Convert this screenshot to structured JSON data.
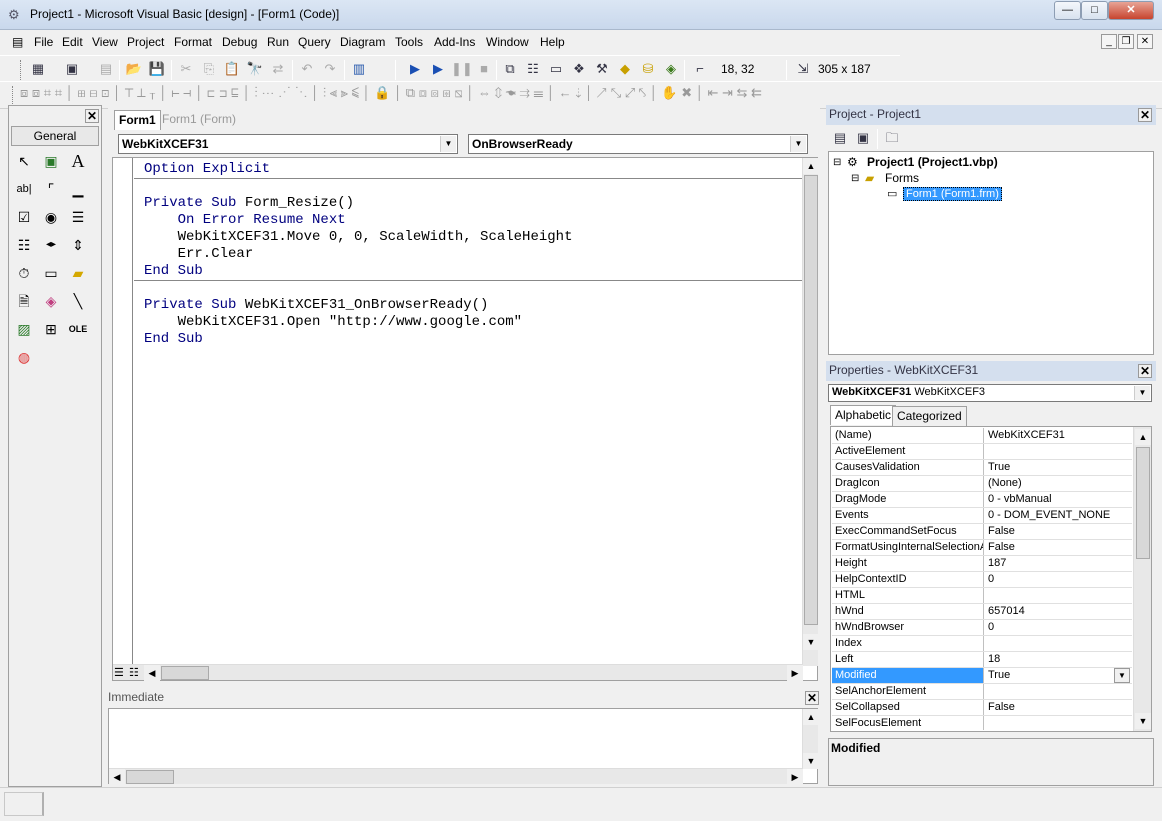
{
  "window": {
    "title": "Project1 - Microsoft Visual Basic [design] - [Form1 (Code)]",
    "buttons": {
      "minimize": "—",
      "maximize": "□",
      "close": "✕"
    }
  },
  "menu": [
    "File",
    "Edit",
    "View",
    "Project",
    "Format",
    "Debug",
    "Run",
    "Query",
    "Diagram",
    "Tools",
    "Add-Ins",
    "Window",
    "Help"
  ],
  "mdi_buttons": {
    "minimize": "_",
    "restore": "❐",
    "close": "✕"
  },
  "toolbar": {
    "position": "18, 32",
    "size": "305 x 187"
  },
  "toolbox": {
    "title": "General",
    "icons": [
      "pointer-icon",
      "picturebox-icon",
      "label-icon",
      "textbox-icon",
      "frame-icon",
      "commandbutton-icon",
      "checkbox-icon",
      "optionbutton-icon",
      "combobox-icon",
      "listbox-icon",
      "hscrollbar-icon",
      "vscrollbar-icon",
      "timer-icon",
      "drivelistbox-icon",
      "dirlistbox-icon",
      "filelistbox-icon",
      "shape-icon",
      "line-icon",
      "image-icon",
      "data-icon",
      "ole-icon",
      "chrome-icon"
    ]
  },
  "code_window": {
    "tabs": [
      "Form1",
      "Form1 (Form)"
    ],
    "object_combo": "WebKitXCEF31",
    "procedure_combo": "OnBrowserReady",
    "lines": [
      {
        "kw": "Option Explicit",
        "rest": ""
      },
      {
        "kw": "",
        "rest": ""
      },
      {
        "kw": "Private Sub",
        "rest": " Form_Resize()"
      },
      {
        "kw": "    On Error Resume Next",
        "rest": ""
      },
      {
        "kw": "",
        "rest": "    WebKitXCEF31.Move 0, 0, ScaleWidth, ScaleHeight"
      },
      {
        "kw": "",
        "rest": "    Err.Clear"
      },
      {
        "kw": "End Sub",
        "rest": ""
      },
      {
        "kw": "",
        "rest": ""
      },
      {
        "kw": "Private Sub",
        "rest": " WebKitXCEF31_OnBrowserReady()"
      },
      {
        "kw": "",
        "rest": "    WebKitXCEF31.Open \"http://www.google.com\""
      },
      {
        "kw": "End Sub",
        "rest": ""
      }
    ]
  },
  "immediate": {
    "title": "Immediate"
  },
  "project": {
    "title": "Project - Project1",
    "root": "Project1 (Project1.vbp)",
    "folder": "Forms",
    "item": "Form1 (Form1.frm)"
  },
  "properties": {
    "title": "Properties - WebKitXCEF31",
    "object_name": "WebKitXCEF31",
    "object_type": "WebKitXCEF3",
    "tabs": [
      "Alphabetic",
      "Categorized"
    ],
    "rows": [
      {
        "name": "(Name)",
        "value": "WebKitXCEF31"
      },
      {
        "name": "ActiveElement",
        "value": ""
      },
      {
        "name": "CausesValidation",
        "value": "True"
      },
      {
        "name": "DragIcon",
        "value": "(None)"
      },
      {
        "name": "DragMode",
        "value": "0 - vbManual"
      },
      {
        "name": "Events",
        "value": "0 - DOM_EVENT_NONE"
      },
      {
        "name": "ExecCommandSetFocus",
        "value": "False"
      },
      {
        "name": "FormatUsingInternalSelectionAr",
        "value": "False"
      },
      {
        "name": "Height",
        "value": "187"
      },
      {
        "name": "HelpContextID",
        "value": "0"
      },
      {
        "name": "HTML",
        "value": ""
      },
      {
        "name": "hWnd",
        "value": "657014"
      },
      {
        "name": "hWndBrowser",
        "value": "0"
      },
      {
        "name": "Index",
        "value": ""
      },
      {
        "name": "Left",
        "value": "18"
      },
      {
        "name": "Modified",
        "value": "True"
      },
      {
        "name": "SelAnchorElement",
        "value": ""
      },
      {
        "name": "SelCollapsed",
        "value": "False"
      },
      {
        "name": "SelFocusElement",
        "value": ""
      }
    ],
    "selected_index": 15,
    "description_title": "Modified"
  }
}
